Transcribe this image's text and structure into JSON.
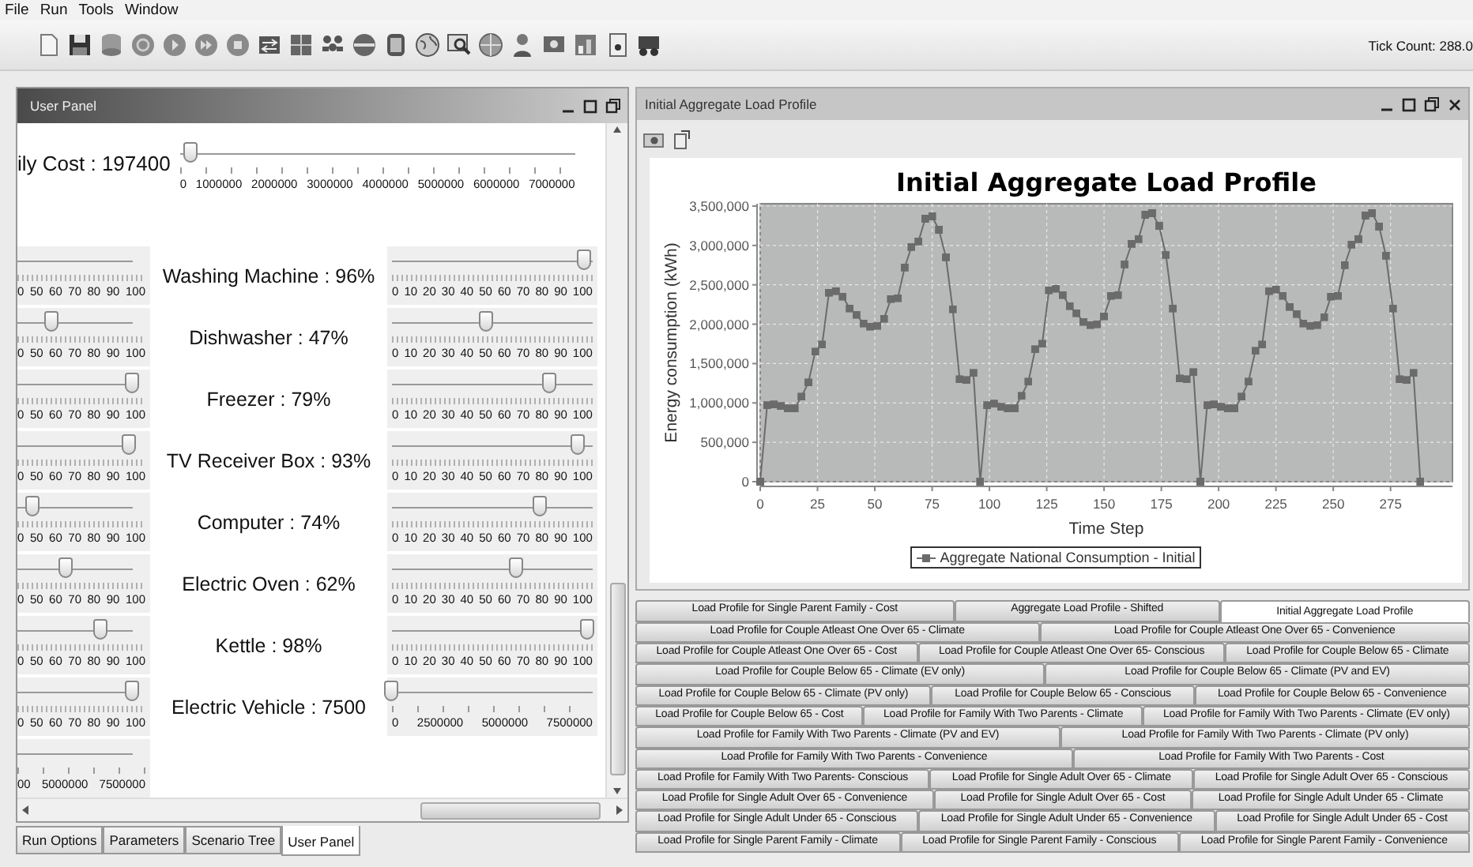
{
  "menu": [
    "File",
    "Run",
    "Tools",
    "Window"
  ],
  "tick_count": "Tick Count: 288.0",
  "user_panel": {
    "title": "User Panel",
    "cost": {
      "label": "ily Cost : 197400",
      "slider": {
        "level": 0.03,
        "ticks": [
          "0",
          "1000000",
          "2000000",
          "3000000",
          "4000000",
          "5000000",
          "6000000",
          "7000000"
        ]
      }
    },
    "rows": [
      {
        "label": "Washing Machine : 96%",
        "left": {
          "ticks": [
            "0",
            "50",
            "60",
            "70",
            "80",
            "90",
            "100"
          ]
        },
        "right": {
          "level": 0.96,
          "ticks": [
            "0",
            "10",
            "20",
            "30",
            "40",
            "50",
            "60",
            "70",
            "80",
            "90",
            "100"
          ]
        }
      },
      {
        "label": "Dishwasher : 47%",
        "left": {
          "level": 0.3,
          "ticks": [
            "0",
            "50",
            "60",
            "70",
            "80",
            "90",
            "100"
          ]
        },
        "right": {
          "level": 0.47,
          "ticks": [
            "0",
            "10",
            "20",
            "30",
            "40",
            "50",
            "60",
            "70",
            "80",
            "90",
            "100"
          ]
        }
      },
      {
        "label": "Freezer : 79%",
        "left": {
          "level": 1.0,
          "ticks": [
            "0",
            "50",
            "60",
            "70",
            "80",
            "90",
            "100"
          ]
        },
        "right": {
          "level": 0.79,
          "ticks": [
            "0",
            "10",
            "20",
            "30",
            "40",
            "50",
            "60",
            "70",
            "80",
            "90",
            "100"
          ]
        }
      },
      {
        "label": "TV Receiver Box : 93%",
        "left": {
          "level": 0.97,
          "ticks": [
            "0",
            "50",
            "60",
            "70",
            "80",
            "90",
            "100"
          ]
        },
        "right": {
          "level": 0.93,
          "ticks": [
            "0",
            "10",
            "20",
            "30",
            "40",
            "50",
            "60",
            "70",
            "80",
            "90",
            "100"
          ]
        }
      },
      {
        "label": "Computer : 74%",
        "left": {
          "level": 0.14,
          "ticks": [
            "0",
            "50",
            "60",
            "70",
            "80",
            "90",
            "100"
          ]
        },
        "right": {
          "level": 0.74,
          "ticks": [
            "0",
            "10",
            "20",
            "30",
            "40",
            "50",
            "60",
            "70",
            "80",
            "90",
            "100"
          ]
        }
      },
      {
        "label": "Electric Oven : 62%",
        "left": {
          "level": 0.43,
          "ticks": [
            "0",
            "50",
            "60",
            "70",
            "80",
            "90",
            "100"
          ]
        },
        "right": {
          "level": 0.62,
          "ticks": [
            "0",
            "10",
            "20",
            "30",
            "40",
            "50",
            "60",
            "70",
            "80",
            "90",
            "100"
          ]
        }
      },
      {
        "label": "Kettle : 98%",
        "left": {
          "level": 0.73,
          "ticks": [
            "0",
            "50",
            "60",
            "70",
            "80",
            "90",
            "100"
          ]
        },
        "right": {
          "level": 0.98,
          "ticks": [
            "0",
            "10",
            "20",
            "30",
            "40",
            "50",
            "60",
            "70",
            "80",
            "90",
            "100"
          ]
        }
      },
      {
        "label": "Electric Vehicle : 7500",
        "left": {
          "level": 1.0,
          "ticks": [
            "0",
            "50",
            "60",
            "70",
            "80",
            "90",
            "100"
          ]
        },
        "right": {
          "level": 0.0,
          "ticks": [
            "0",
            "2500000",
            "5000000",
            "7500000"
          ]
        }
      }
    ],
    "extra_left": {
      "ticks": [
        "00",
        "5000000",
        "7500000"
      ]
    },
    "tabs": [
      {
        "label": "Run Options",
        "selected": false
      },
      {
        "label": "Parameters",
        "selected": false
      },
      {
        "label": "Scenario Tree",
        "selected": false
      },
      {
        "label": "User Panel",
        "selected": true
      }
    ]
  },
  "chart_window": {
    "title": "Initial Aggregate Load Profile",
    "chart_data": {
      "type": "line",
      "grid": true,
      "title": "Initial Aggregate Load Profile",
      "xlabel": "Time Step",
      "ylabel": "Energy consumption (kWh)",
      "x": [
        0,
        3,
        6,
        9,
        12,
        15,
        18,
        21,
        24,
        27,
        30,
        33,
        36,
        39,
        42,
        45,
        48,
        51,
        54,
        57,
        60,
        63,
        66,
        69,
        72,
        75,
        78,
        81,
        84,
        87,
        90,
        93,
        96,
        99,
        102,
        105,
        108,
        111,
        114,
        117,
        120,
        123,
        126,
        129,
        132,
        135,
        138,
        141,
        144,
        147,
        150,
        153,
        156,
        159,
        162,
        165,
        168,
        171,
        174,
        177,
        180,
        183,
        186,
        189,
        192,
        195,
        198,
        201,
        204,
        207,
        210,
        213,
        216,
        219,
        222,
        225,
        228,
        231,
        234,
        237,
        240,
        243,
        246,
        249,
        252,
        255,
        258,
        261,
        264,
        267,
        270,
        273,
        276,
        279,
        282,
        285,
        288
      ],
      "series": [
        {
          "name": "Aggregate National Consumption - Initial",
          "color": "#6b6b6b",
          "values": [
            0,
            970000,
            980000,
            960000,
            930000,
            930000,
            1080000,
            1260000,
            1650000,
            1740000,
            2400000,
            2420000,
            2350000,
            2200000,
            2120000,
            2010000,
            1970000,
            1980000,
            2070000,
            2320000,
            2330000,
            2720000,
            2980000,
            3050000,
            3340000,
            3370000,
            3200000,
            2850000,
            2190000,
            1300000,
            1290000,
            1380000,
            0,
            970000,
            990000,
            950000,
            930000,
            930000,
            1090000,
            1270000,
            1680000,
            1750000,
            2430000,
            2450000,
            2370000,
            2230000,
            2140000,
            2030000,
            1990000,
            2000000,
            2100000,
            2360000,
            2370000,
            2760000,
            3020000,
            3080000,
            3390000,
            3410000,
            3250000,
            2880000,
            2200000,
            1310000,
            1300000,
            1390000,
            0,
            970000,
            980000,
            950000,
            930000,
            930000,
            1080000,
            1270000,
            1660000,
            1740000,
            2420000,
            2440000,
            2360000,
            2220000,
            2130000,
            2010000,
            1980000,
            1990000,
            2090000,
            2350000,
            2360000,
            2750000,
            3010000,
            3080000,
            3380000,
            3410000,
            3240000,
            2870000,
            2200000,
            1300000,
            1290000,
            1380000,
            0
          ]
        }
      ],
      "xlim": [
        0,
        302
      ],
      "ylim": [
        0,
        3530000
      ],
      "xticks": [
        0,
        25,
        50,
        75,
        100,
        125,
        150,
        175,
        200,
        225,
        250,
        275
      ],
      "yticks": [
        {
          "value": 0,
          "label": "0"
        },
        {
          "value": 500000,
          "label": "500,000"
        },
        {
          "value": 1000000,
          "label": "1,000,000"
        },
        {
          "value": 1500000,
          "label": "1,500,000"
        },
        {
          "value": 2000000,
          "label": "2,000,000"
        },
        {
          "value": 2500000,
          "label": "2,500,000"
        },
        {
          "value": 3000000,
          "label": "3,000,000"
        },
        {
          "value": 3500000,
          "label": "3,500,000"
        }
      ]
    }
  },
  "profile_tabs": [
    {
      "tabs": [
        {
          "label": "Load Profile for Single Parent Family - Cost",
          "selected": false
        },
        {
          "label": "Aggregate Load Profile - Shifted",
          "selected": false
        },
        {
          "label": "Initial Aggregate Load Profile",
          "selected": true
        }
      ]
    },
    {
      "tabs": [
        {
          "label": "Load Profile for Couple Atleast One Over 65 - Climate",
          "selected": false
        },
        {
          "label": "Load Profile for Couple Atleast One Over 65 - Convenience",
          "selected": false
        }
      ]
    },
    {
      "tabs": [
        {
          "label": "Load Profile for Couple Atleast One Over 65 - Cost",
          "selected": false
        },
        {
          "label": "Load Profile for Couple Atleast One Over 65- Conscious",
          "selected": false
        },
        {
          "label": "Load Profile for Couple Below 65 - Climate",
          "selected": false
        }
      ]
    },
    {
      "tabs": [
        {
          "label": "Load Profile for Couple Below 65 - Climate (EV only)",
          "selected": false
        },
        {
          "label": "Load Profile for Couple Below 65 - Climate (PV and EV)",
          "selected": false
        }
      ]
    },
    {
      "tabs": [
        {
          "label": "Load Profile for Couple Below 65 - Climate (PV only)",
          "selected": false
        },
        {
          "label": "Load Profile for Couple Below 65 - Conscious",
          "selected": false
        },
        {
          "label": "Load Profile for Couple Below 65 - Convenience",
          "selected": false
        }
      ]
    },
    {
      "tabs": [
        {
          "label": "Load Profile for Couple Below 65 - Cost",
          "selected": false
        },
        {
          "label": "Load Profile for Family With Two Parents - Climate",
          "selected": false
        },
        {
          "label": "Load Profile for Family With Two Parents - Climate (EV only)",
          "selected": false
        }
      ]
    },
    {
      "tabs": [
        {
          "label": "Load Profile for Family With Two Parents - Climate (PV and EV)",
          "selected": false
        },
        {
          "label": "Load Profile for Family With Two Parents - Climate (PV only)",
          "selected": false
        }
      ]
    },
    {
      "tabs": [
        {
          "label": "Load Profile for Family With Two Parents - Convenience",
          "selected": false
        },
        {
          "label": "Load Profile for Family With Two Parents - Cost",
          "selected": false
        }
      ]
    },
    {
      "tabs": [
        {
          "label": "Load Profile for Family With Two Parents- Conscious",
          "selected": false
        },
        {
          "label": "Load Profile for Single Adult Over 65 - Climate",
          "selected": false
        },
        {
          "label": "Load Profile for Single Adult Over 65 - Conscious",
          "selected": false
        }
      ]
    },
    {
      "tabs": [
        {
          "label": "Load Profile for Single Adult Over 65 - Convenience",
          "selected": false
        },
        {
          "label": "Load Profile for Single Adult Over 65 - Cost",
          "selected": false
        },
        {
          "label": "Load Profile for Single Adult Under 65 - Climate",
          "selected": false
        }
      ]
    },
    {
      "tabs": [
        {
          "label": "Load Profile for Single Adult Under 65 - Conscious",
          "selected": false
        },
        {
          "label": "Load Profile for Single Adult Under 65 - Convenience",
          "selected": false
        },
        {
          "label": "Load Profile for Single Adult Under 65 - Cost",
          "selected": false
        }
      ]
    },
    {
      "tabs": [
        {
          "label": "Load Profile for Single Parent Family - Climate",
          "selected": false
        },
        {
          "label": "Load Profile for Single Parent Family - Conscious",
          "selected": false
        },
        {
          "label": "Load Profile for Single Parent Family - Convenience",
          "selected": false
        }
      ]
    }
  ]
}
